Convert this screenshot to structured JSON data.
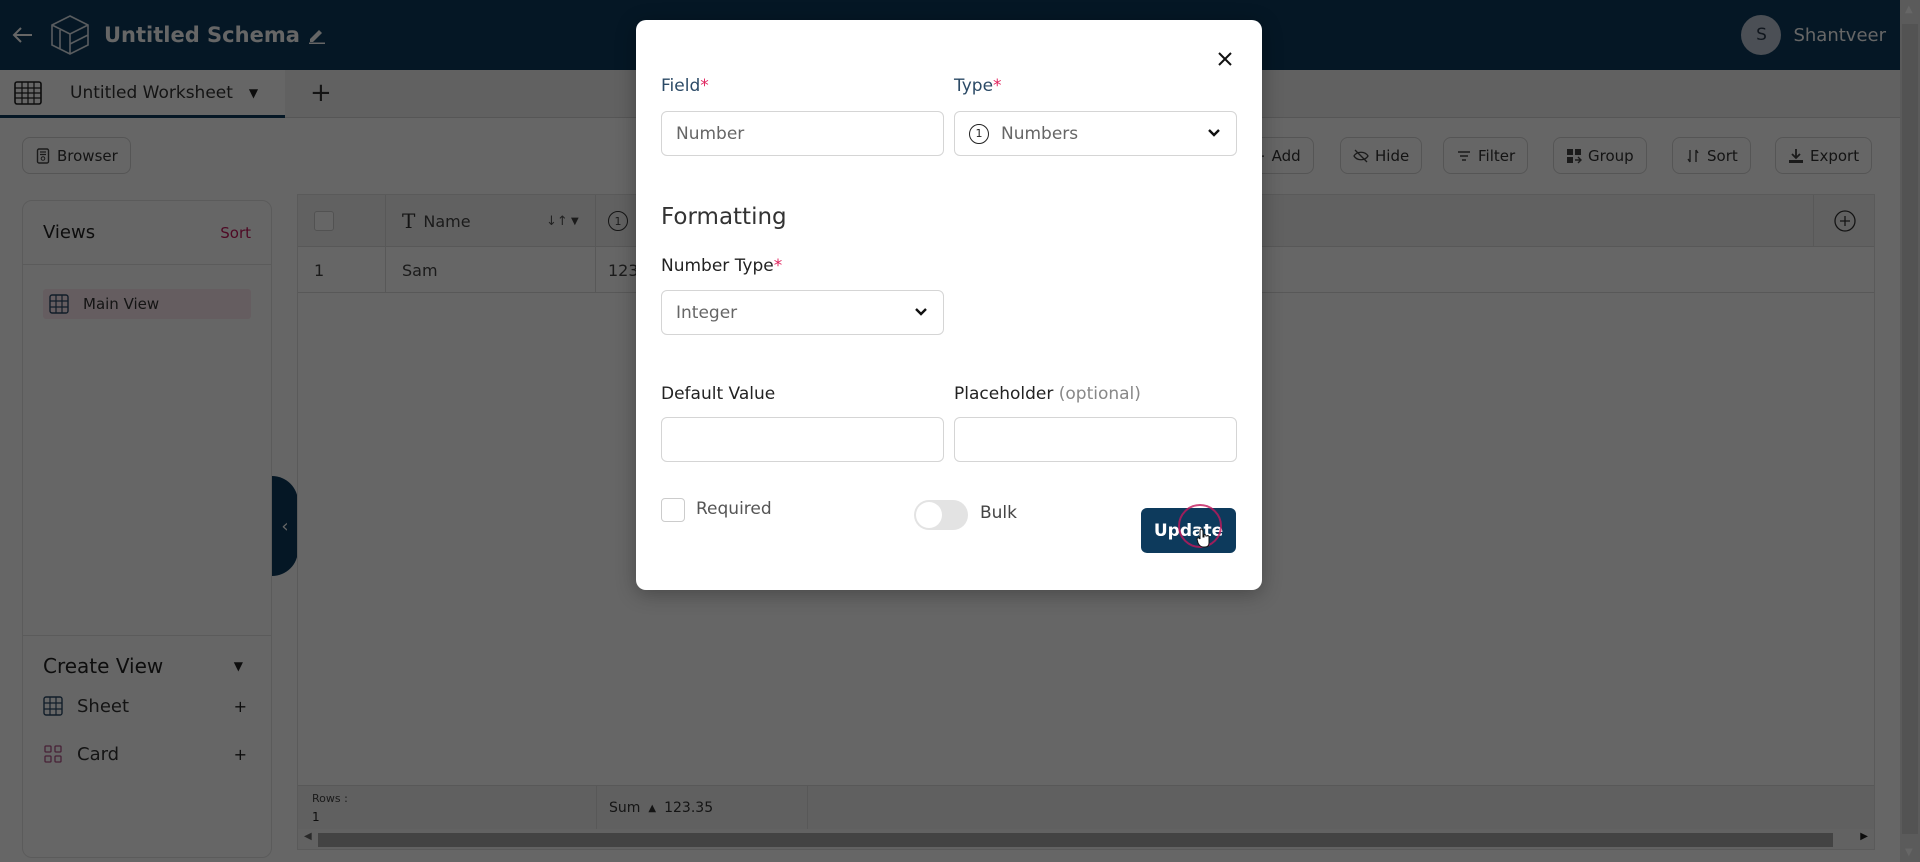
{
  "header": {
    "title": "Untitled Schema",
    "user": {
      "initial": "S",
      "name": "Shantveer"
    }
  },
  "tabs": {
    "active": "Untitled Worksheet"
  },
  "toolbar": {
    "browser": "Browser",
    "add": "Add",
    "hide": "Hide",
    "filter": "Filter",
    "group": "Group",
    "sort": "Sort",
    "export": "Export"
  },
  "sidebar": {
    "views_title": "Views",
    "views_sort": "Sort",
    "views": [
      {
        "label": "Main View"
      }
    ],
    "create_title": "Create View",
    "create_items": [
      {
        "label": "Sheet"
      },
      {
        "label": "Card"
      }
    ]
  },
  "grid": {
    "columns": [
      {
        "label": "Name",
        "icon": "text-type-icon"
      },
      {
        "label": "",
        "icon": "number-type-icon"
      }
    ],
    "rows": [
      {
        "index": "1",
        "name": "Sam",
        "number": "123"
      }
    ],
    "footer": {
      "rows_label": "Rows :",
      "rows_count": "1",
      "agg_label": "Sum",
      "agg_value": "123.35"
    }
  },
  "modal": {
    "field_label": "Field",
    "field_value": "Number",
    "type_label": "Type",
    "type_value": "Numbers",
    "section_title": "Formatting",
    "number_type_label": "Number Type",
    "number_type_value": "Integer",
    "default_label": "Default Value",
    "default_value": "",
    "placeholder_label": "Placeholder",
    "placeholder_optional": "(optional)",
    "placeholder_value": "",
    "required_label": "Required",
    "required_checked": false,
    "bulk_label": "Bulk",
    "bulk_on": false,
    "update_label": "Update",
    "required_marker": "*"
  },
  "colors": {
    "primary": "#0d3a5c",
    "accent": "#c2185b",
    "required": "#e0245e"
  }
}
